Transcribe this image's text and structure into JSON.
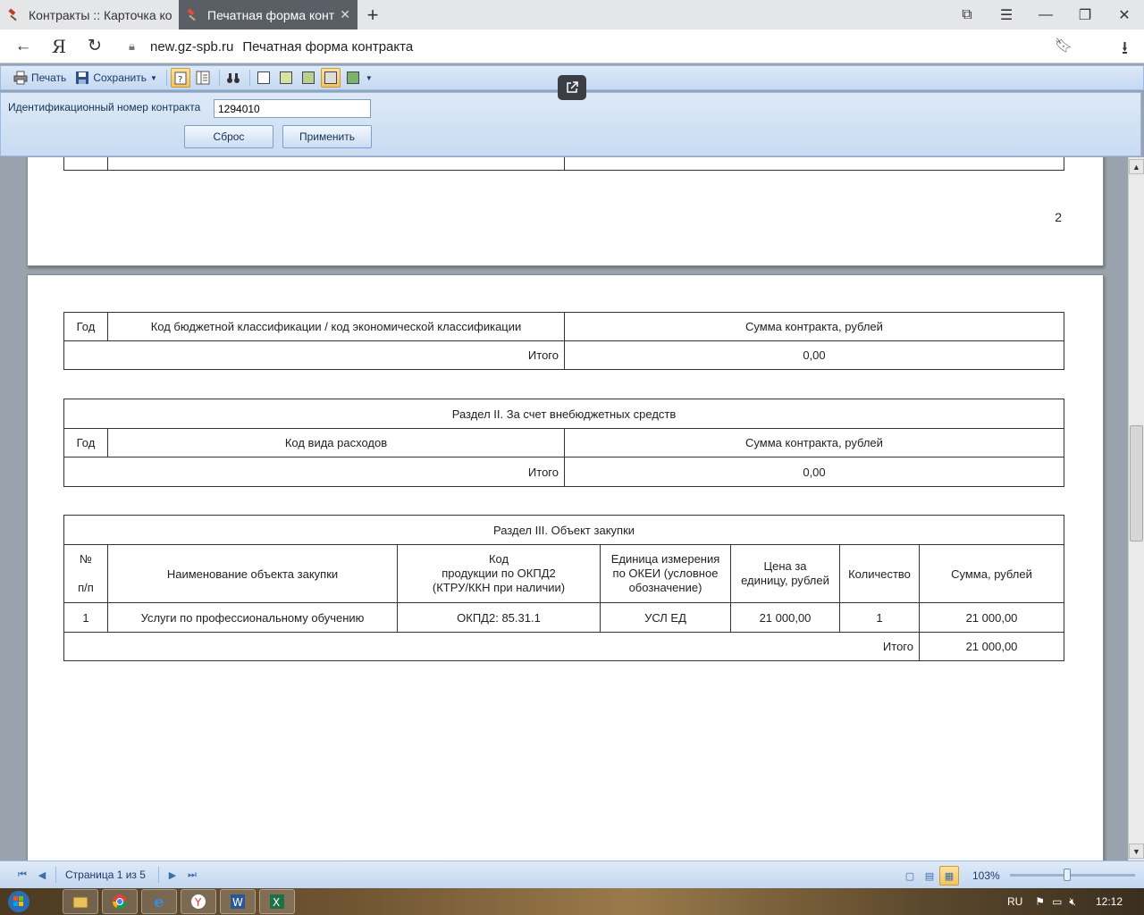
{
  "browser": {
    "tabs": [
      {
        "title": "Контракты :: Карточка кон",
        "active": false
      },
      {
        "title": "Печатная форма контра",
        "active": true
      }
    ],
    "host": "new.gz-spb.ru",
    "page_title": "Печатная форма контракта"
  },
  "toolbar": {
    "print_label": "Печать",
    "save_label": "Сохранить"
  },
  "params": {
    "field_label": "Идентификационный номер контракта",
    "field_value": "1294010",
    "reset_label": "Сброс",
    "apply_label": "Применить"
  },
  "page1": {
    "page_number": "2"
  },
  "section_budget": {
    "col_year": "Год",
    "col_code": "Код бюджетной классификации / код экономической классификации",
    "col_sum": "Сумма контракта, рублей",
    "total_label": "Итого",
    "total_value": "0,00"
  },
  "section2": {
    "title": "Раздел II. За счет внебюджетных средств",
    "col_year": "Год",
    "col_code": "Код вида расходов",
    "col_sum": "Сумма контракта, рублей",
    "total_label": "Итого",
    "total_value": "0,00"
  },
  "section3": {
    "title": "Раздел III. Объект закупки",
    "col_num_1": "№",
    "col_num_2": "п/п",
    "col_name": "Наименование объекта закупки",
    "col_code_1": "Код",
    "col_code_2": "продукции по ОКПД2",
    "col_code_3": "(КТРУ/ККН при наличии)",
    "col_unit_1": "Единица измерения",
    "col_unit_2": "по ОКЕИ (условное",
    "col_unit_3": "обозначение)",
    "col_price_1": "Цена за",
    "col_price_2": "единицу, рублей",
    "col_qty": "Количество",
    "col_sum": "Сумма, рублей",
    "rows": [
      {
        "num": "1",
        "name": "Услуги по профессиональному обучению",
        "code": "ОКПД2: 85.31.1",
        "unit": "УСЛ ЕД",
        "price": "21 000,00",
        "qty": "1",
        "sum": "21 000,00"
      }
    ],
    "total_label": "Итого",
    "total_value": "21 000,00"
  },
  "statusbar": {
    "page_info": "Страница 1 из 5",
    "zoom": "103%",
    "zoom_level_fraction": 0.46
  },
  "taskbar": {
    "lang": "RU",
    "time": "12:12"
  }
}
